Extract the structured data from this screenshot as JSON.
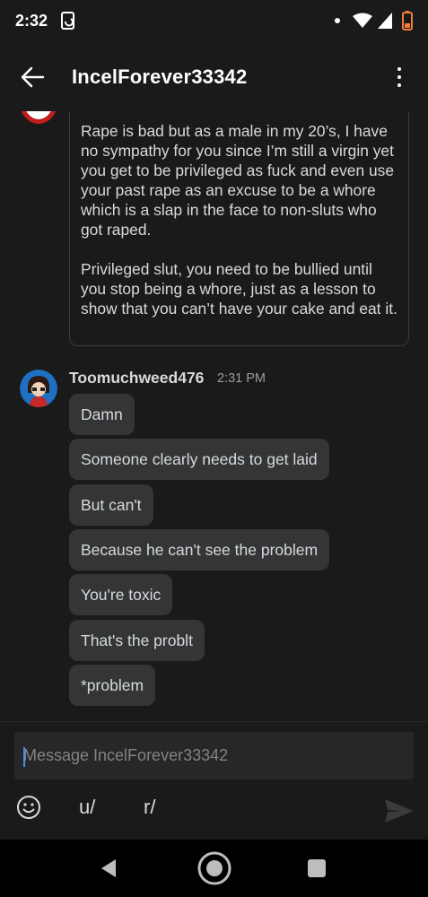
{
  "status_bar": {
    "time": "2:32"
  },
  "header": {
    "title": "IncelForever33342"
  },
  "messages": {
    "previous_message_text": "Rape is bad but as a male in my 20’s, I have no sympathy for you since I’m still a virgin yet you get to be privileged as fuck and even use your past rape as an excuse to be a whore which is a slap in the face to non-sluts who got raped.\n\nPrivileged slut, you need to be bullied until you stop being a whore, just as a lesson to show that you can’t have your cake and eat it.",
    "group": {
      "sender": "Toomuchweed476",
      "time": "2:31 PM",
      "bubbles": [
        "Damn",
        "Someone clearly needs to get laid",
        "But can't",
        "Because he can't see the problem",
        "You're toxic",
        "That's the problt",
        "*problem"
      ]
    }
  },
  "composer": {
    "placeholder": "Message IncelForever33342",
    "user_prefix": "u/",
    "subreddit_prefix": "r/"
  },
  "colors": {
    "background": "#1a1a1b",
    "bubble": "#343536",
    "text": "#d7dadc",
    "muted": "#9a9c9f",
    "caret": "#4a8ee8"
  },
  "icons": {
    "back": "arrow-left-icon",
    "overflow": "more-vertical-icon",
    "emoji": "smiley-icon",
    "send": "send-icon"
  }
}
